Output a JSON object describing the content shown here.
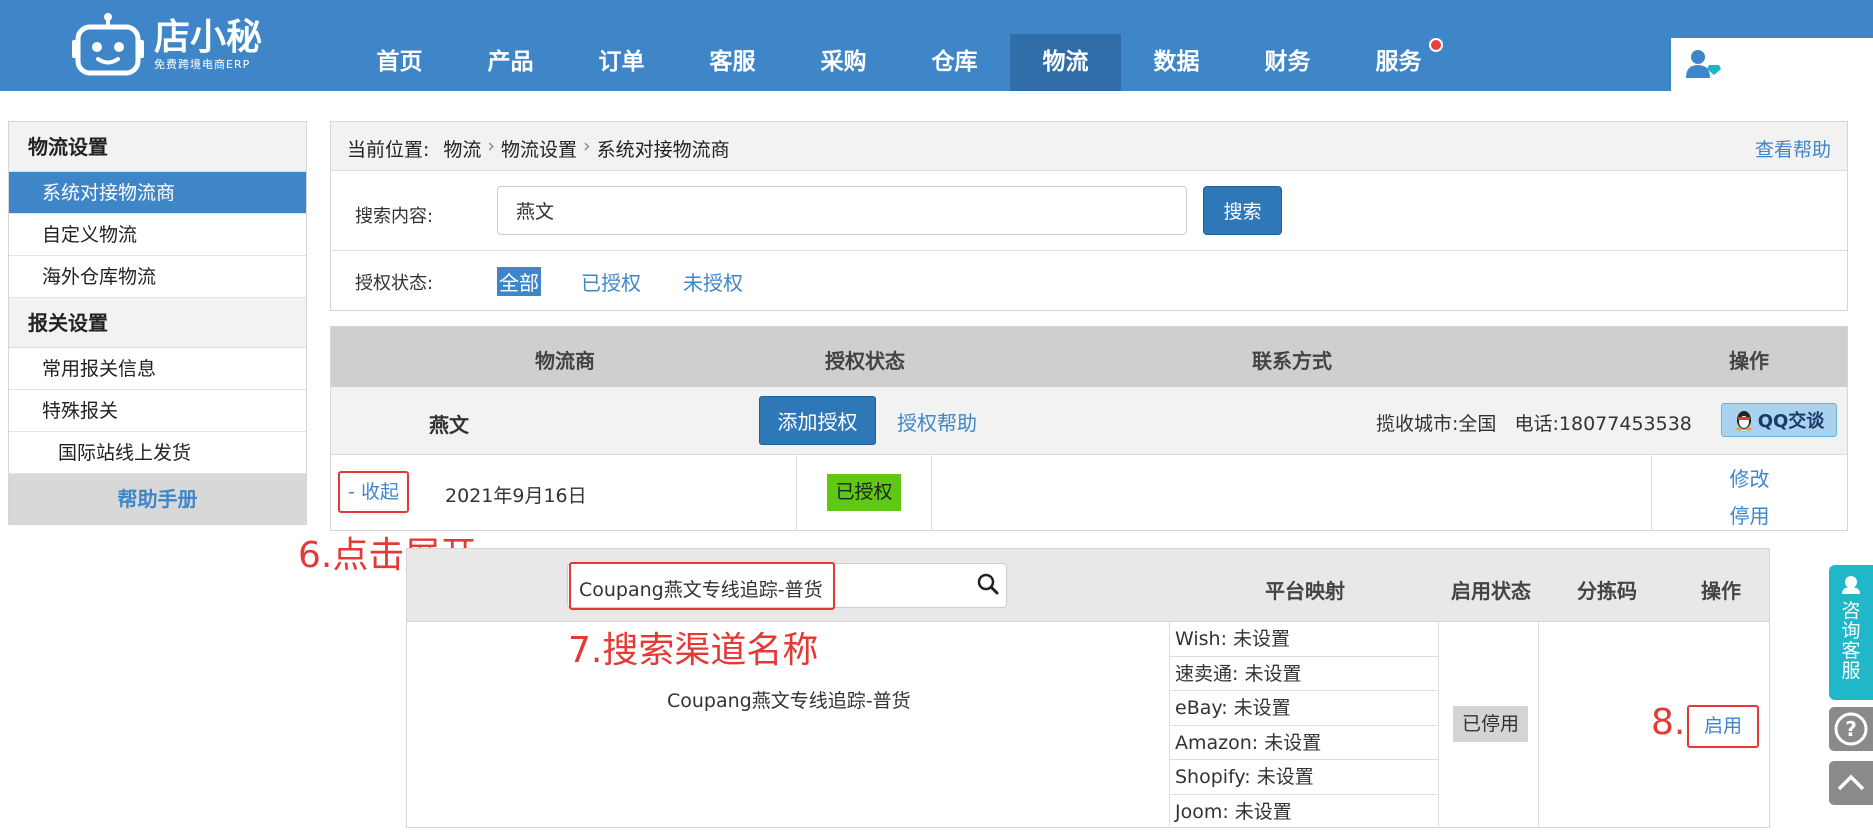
{
  "header": {
    "logo_name": "店小秘",
    "logo_sub": "免费跨境电商ERP",
    "nav": [
      "首页",
      "产品",
      "订单",
      "客服",
      "采购",
      "仓库",
      "物流",
      "数据",
      "财务",
      "服务"
    ],
    "active_nav": "物流",
    "accent": "#3f86c9"
  },
  "sidebar": {
    "group1": "物流设置",
    "items1": [
      "系统对接物流商",
      "自定义物流",
      "海外仓库物流"
    ],
    "group2": "报关设置",
    "items2": [
      "常用报关信息",
      "特殊报关",
      "国际站线上发货"
    ],
    "help": "帮助手册"
  },
  "breadcrumb": {
    "label": "当前位置:",
    "items": [
      "物流",
      "物流设置",
      "系统对接物流商"
    ],
    "help": "查看帮助"
  },
  "search": {
    "label": "搜索内容:",
    "value": "燕文",
    "button": "搜索"
  },
  "auth_filter": {
    "label": "授权状态:",
    "options": [
      "全部",
      "已授权",
      "未授权"
    ],
    "selected": "全部"
  },
  "table": {
    "headers": [
      "物流商",
      "授权状态",
      "联系方式",
      "操作"
    ],
    "carrier": {
      "name": "燕文",
      "add_auth": "添加授权",
      "auth_help": "授权帮助",
      "contact": "揽收城市:全国   电话:18077453538",
      "qq": "QQ交谈"
    },
    "detail": {
      "collapse": "- 收起",
      "date": "2021年9月16日",
      "status": "已授权",
      "edit": "修改",
      "disable": "停用"
    }
  },
  "annotations": {
    "step6": "6.点击展开",
    "step7": "7.搜索渠道名称",
    "step8": "8."
  },
  "channel_table": {
    "search_value": "Coupang燕文专线追踪-普货",
    "headers": [
      "平台映射",
      "启用状态",
      "分拣码",
      "操作"
    ],
    "channel_name": "Coupang燕文专线追踪-普货",
    "mappings": [
      "Wish:  未设置",
      "速卖通:  未设置",
      "eBay:  未设置",
      "Amazon:  未设置",
      "Shopify:  未设置",
      "Joom:  未设置"
    ],
    "status": "已停用",
    "action": "启用"
  },
  "float": {
    "service": "咨询客服"
  }
}
